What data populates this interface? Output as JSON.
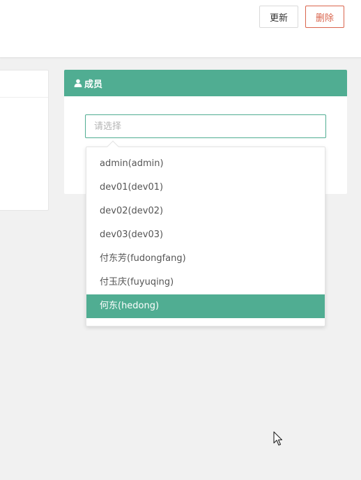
{
  "toolbar": {
    "update_label": "更新",
    "delete_label": "删除"
  },
  "member_panel": {
    "title": "成员",
    "icon": "user-icon",
    "accent_color": "#50ad92"
  },
  "select": {
    "placeholder": "请选择",
    "value": ""
  },
  "dropdown": {
    "options": [
      {
        "label": "admin(admin)",
        "selected": false
      },
      {
        "label": "dev01(dev01)",
        "selected": false
      },
      {
        "label": "dev02(dev02)",
        "selected": false
      },
      {
        "label": "dev03(dev03)",
        "selected": false
      },
      {
        "label": "付东芳(fudongfang)",
        "selected": false
      },
      {
        "label": "付玉庆(fuyuqing)",
        "selected": false
      },
      {
        "label": "何东(hedong)",
        "selected": true
      },
      {
        "label": "",
        "selected": false
      }
    ]
  }
}
